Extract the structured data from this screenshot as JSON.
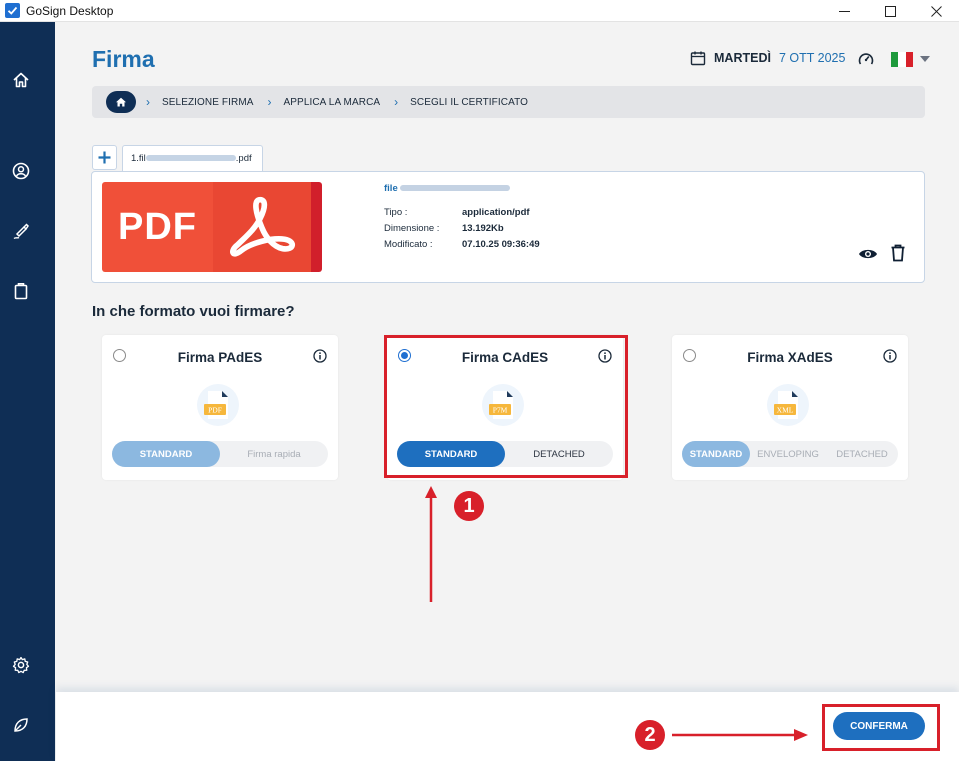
{
  "window": {
    "title": "GoSign Desktop"
  },
  "header": {
    "title": "Firma",
    "date_day": "MARTEDÌ",
    "date_value": "7 OTT 2025"
  },
  "breadcrumb": [
    "SELEZIONE FIRMA",
    "APPLICA LA MARCA",
    "SCEGLI IL CERTIFICATO"
  ],
  "file_tab": {
    "label_prefix": "1.fil",
    "label_suffix": ".pdf"
  },
  "file": {
    "thumb_text": "PDF",
    "name_prefix": "file",
    "labels": {
      "type": "Tipo :",
      "size": "Dimensione :",
      "modified": "Modificato :"
    },
    "type": "application/pdf",
    "size": "13.192Kb",
    "modified": "07.10.25 09:36:49"
  },
  "question": "In che formato vuoi firmare?",
  "formats": [
    {
      "title": "Firma PAdES",
      "ext": "PDF",
      "selected": false,
      "options": [
        "STANDARD",
        "Firma rapida"
      ]
    },
    {
      "title": "Firma CAdES",
      "ext": "P7M",
      "selected": true,
      "options": [
        "STANDARD",
        "DETACHED"
      ]
    },
    {
      "title": "Firma XAdES",
      "ext": "XML",
      "selected": false,
      "options": [
        "STANDARD",
        "ENVELOPING",
        "DETACHED"
      ]
    }
  ],
  "annotations": {
    "badge_1": "1",
    "badge_2": "2"
  },
  "footer": {
    "confirm_label": "CONFERMA"
  },
  "colors": {
    "sidebar": "#0f2e55",
    "accent": "#1e6fbf",
    "highlight": "#d8202a"
  }
}
